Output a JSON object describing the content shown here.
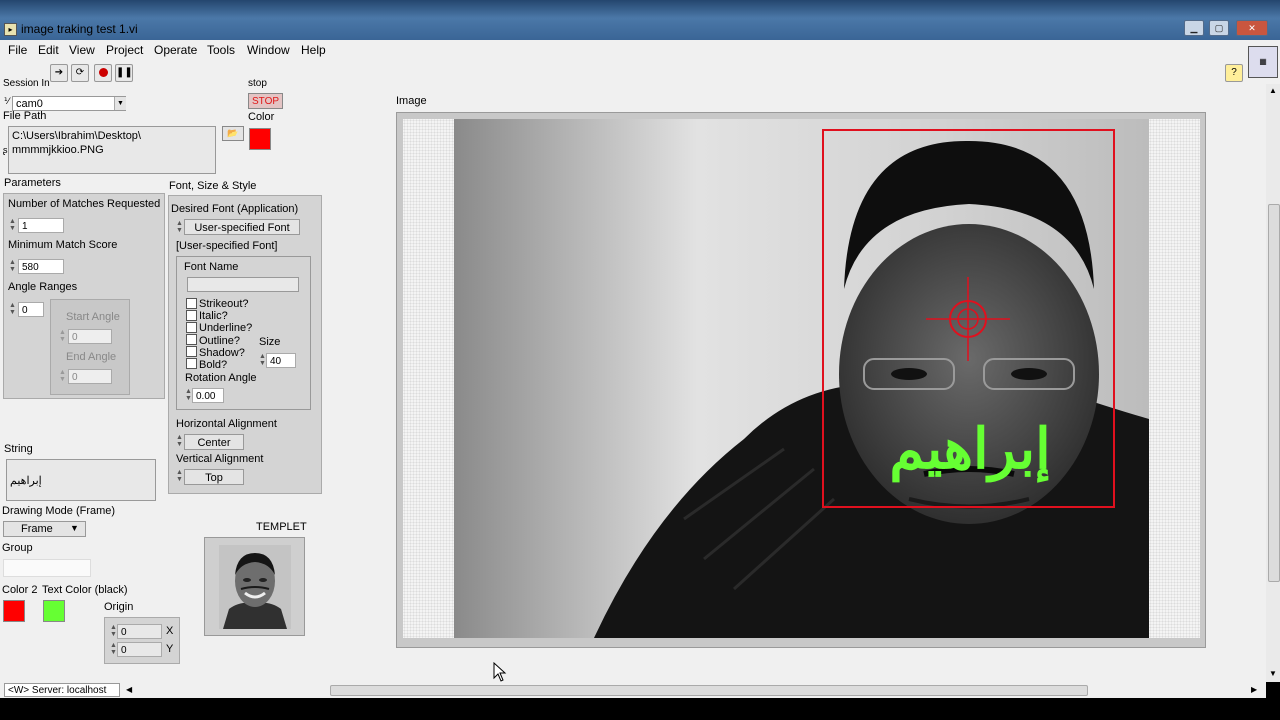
{
  "window": {
    "title": "image traking test 1.vi"
  },
  "menu": [
    "File",
    "Edit",
    "View",
    "Project",
    "Operate",
    "Tools",
    "Window",
    "Help"
  ],
  "session": {
    "label": "Session In",
    "value": "cam0"
  },
  "stop": {
    "label": "stop",
    "button": "STOP"
  },
  "color": {
    "label": "Color",
    "value": "#ff0000"
  },
  "file_path": {
    "label": "File Path",
    "line1": "C:\\Users\\Ibrahim\\Desktop\\",
    "line2": "mmmmjkkioo.PNG"
  },
  "parameters": {
    "label": "Parameters",
    "matches_label": "Number of Matches Requested",
    "matches_value": "1",
    "score_label": "Minimum Match Score",
    "score_value": "580",
    "angle_label": "Angle Ranges",
    "angle_index": "0",
    "start_label": "Start Angle",
    "start_value": "0",
    "end_label": "End Angle",
    "end_value": "0"
  },
  "font": {
    "label": "Font, Size & Style",
    "desired_label": "Desired Font (Application)",
    "desired_value": "User-specified Font",
    "user_label": "[User-specified Font]",
    "name_label": "Font Name",
    "name_value": "",
    "options": [
      "Strikeout?",
      "Italic?",
      "Underline?",
      "Outline?",
      "Shadow?",
      "Bold?"
    ],
    "size_label": "Size",
    "size_value": "40",
    "rotation_label": "Rotation Angle",
    "rotation_value": "0.00",
    "halign_label": "Horizontal Alignment",
    "halign_value": "Center",
    "valign_label": "Vertical Alignment",
    "valign_value": "Top"
  },
  "string": {
    "label": "String",
    "value": "إبراهيم"
  },
  "drawing_mode": {
    "label": "Drawing Mode (Frame)",
    "value": "Frame"
  },
  "group": {
    "label": "Group",
    "value": ""
  },
  "color2": {
    "label": "Color 2",
    "value": "#ff0000"
  },
  "text_color": {
    "label": "Text Color (black)",
    "value": "#66ff33"
  },
  "origin": {
    "label": "Origin",
    "x_value": "0",
    "y_value": "0",
    "x_label": "X",
    "y_label": "Y"
  },
  "templet": {
    "label": "TEMPLET"
  },
  "image": {
    "label": "Image",
    "overlay_text": "إبراهيم"
  },
  "status": {
    "server": "<W> Server: localhost"
  }
}
